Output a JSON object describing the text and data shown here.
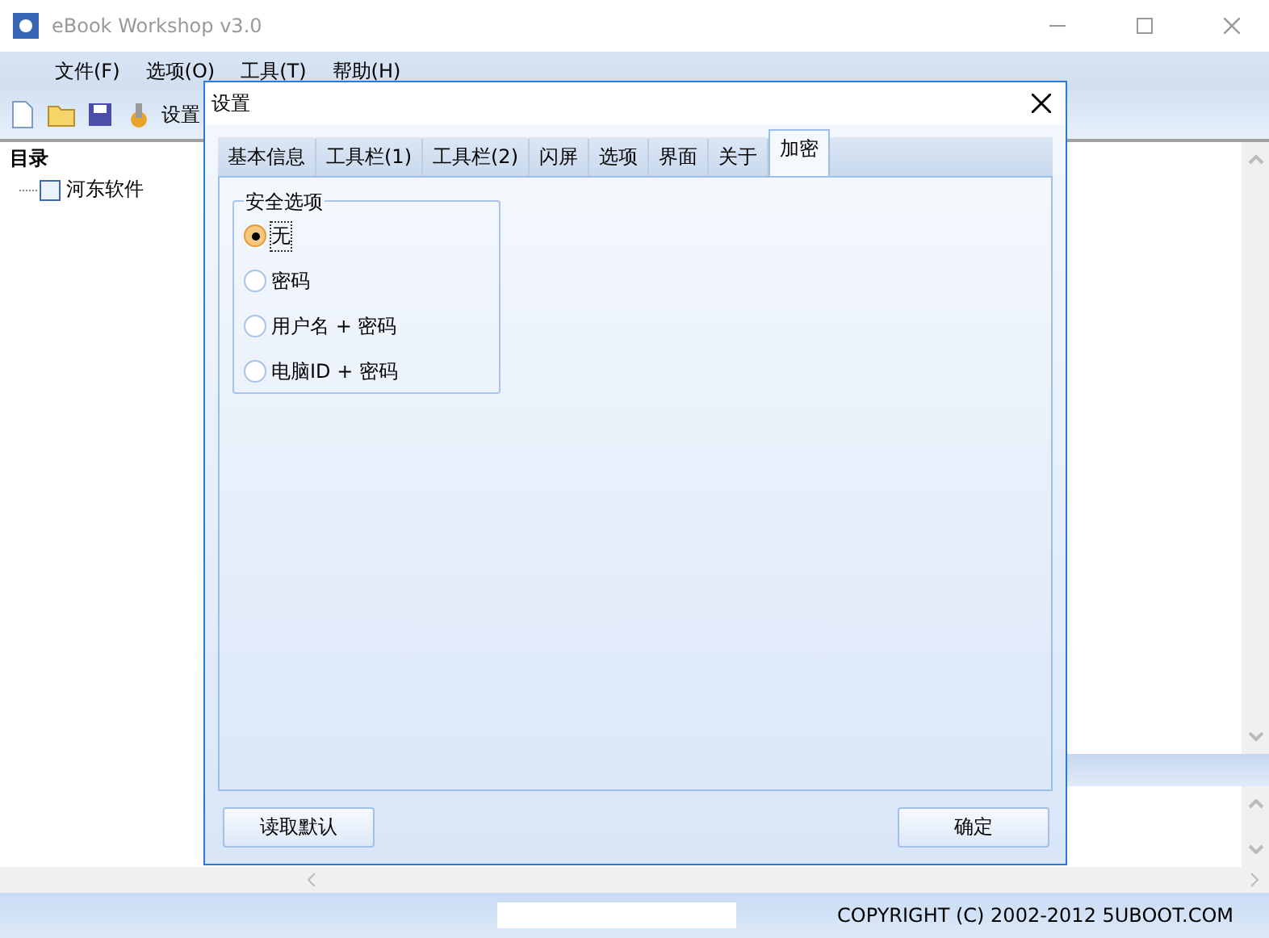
{
  "window": {
    "title": "eBook Workshop v3.0"
  },
  "menu": [
    "文件(F)",
    "选项(O)",
    "工具(T)",
    "帮助(H)"
  ],
  "toolbar": {
    "settings_label": "设置"
  },
  "sidebar": {
    "title": "目录",
    "tree": [
      {
        "label": "河东软件"
      }
    ]
  },
  "status_bar": {
    "copyright": "COPYRIGHT (C) 2002-2012 5UBOOT.COM"
  },
  "dialog": {
    "title": "设置",
    "tabs": [
      {
        "label": "基本信息",
        "selected": false
      },
      {
        "label": "工具栏(1)",
        "selected": false
      },
      {
        "label": "工具栏(2)",
        "selected": false
      },
      {
        "label": "闪屏",
        "selected": false
      },
      {
        "label": "选项",
        "selected": false
      },
      {
        "label": "界面",
        "selected": false
      },
      {
        "label": "关于",
        "selected": false
      },
      {
        "label": "加密",
        "selected": true
      }
    ],
    "group": {
      "title": "安全选项",
      "options": [
        {
          "label": "无",
          "selected": true
        },
        {
          "label": "密码",
          "selected": false
        },
        {
          "label": "用户名 + 密码",
          "selected": false
        },
        {
          "label": "电脑ID + 密码",
          "selected": false
        }
      ]
    },
    "buttons": [
      {
        "label": "读取默认"
      },
      {
        "label": "确定"
      }
    ]
  }
}
